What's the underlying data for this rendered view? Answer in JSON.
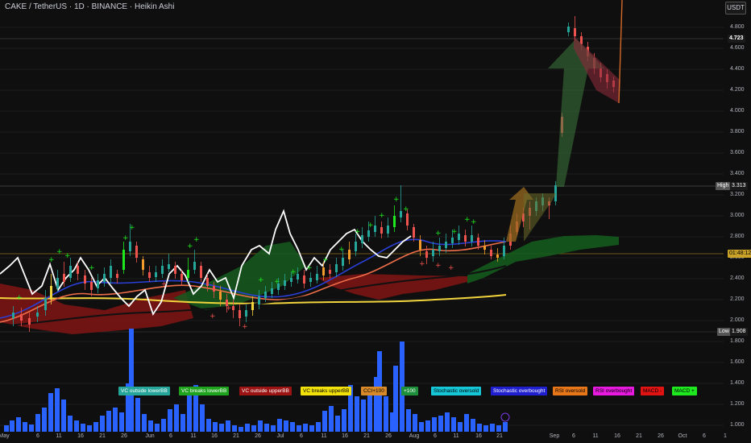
{
  "header": {
    "title": "CAKE / TetherUS · 1D · BINANCE · Heikin Ashi",
    "currency": "USDT"
  },
  "price_axis": {
    "ticks": [
      "4.800",
      "4.600",
      "4.400",
      "4.200",
      "4.000",
      "3.800",
      "3.600",
      "3.400",
      "3.200",
      "3.000",
      "2.800",
      "2.600",
      "2.400",
      "2.200",
      "2.000",
      "1.800",
      "1.600",
      "1.400",
      "1.200",
      "1.000"
    ],
    "current_price": "4.723",
    "high_label": "High",
    "high_value": "3.313",
    "timer": "01:48:12",
    "low_label": "Low",
    "low_value": "1.908"
  },
  "time_axis": {
    "labels": [
      "May",
      "6",
      "11",
      "16",
      "21",
      "26",
      "Jun",
      "6",
      "11",
      "16",
      "21",
      "26",
      "Jul",
      "6",
      "11",
      "16",
      "21",
      "26",
      "Aug",
      "6",
      "11",
      "16",
      "21",
      "Sep",
      "6",
      "11",
      "16",
      "21",
      "26",
      "Oct",
      "6",
      "1"
    ]
  },
  "signals": [
    {
      "label": "VC outside lowerBB",
      "color": "#26a69a",
      "text_color": "#ffffff"
    },
    {
      "label": "VC breaks lowerBB",
      "color": "#1fa31f",
      "text_color": "#ffffff"
    },
    {
      "label": "VC outside upperBB",
      "color": "#9b1313",
      "text_color": "#ffffff"
    },
    {
      "label": "VC breaks upperBB",
      "color": "#f2e20a",
      "text_color": "#000000"
    },
    {
      "label": "CCI+100",
      "color": "#d88a2a",
      "text_color": "#000000"
    },
    {
      "label": "+100",
      "color": "#1e8f3a",
      "text_color": "#ffffff"
    },
    {
      "label": "Stochastic oversold",
      "color": "#15c6d6",
      "text_color": "#000000"
    },
    {
      "label": "Stochastic overbought",
      "color": "#1f1fcf",
      "text_color": "#ffffff"
    },
    {
      "label": "RSI oversold",
      "color": "#e8771a",
      "text_color": "#000000"
    },
    {
      "label": "RSI overbought",
      "color": "#e81ae0",
      "text_color": "#000000"
    },
    {
      "label": "MACD -",
      "color": "#e01313",
      "text_color": "#000000"
    },
    {
      "label": "MACD +",
      "color": "#1ee81e",
      "text_color": "#000000"
    }
  ],
  "colors": {
    "background": "#0f0f0f",
    "up_candle": "#26a69a",
    "down_candle": "#ef5350",
    "volume": "#2962ff",
    "price_line": "#3179f5",
    "high_line": "#6b6b6b",
    "timer_line": "#c9a227"
  }
}
